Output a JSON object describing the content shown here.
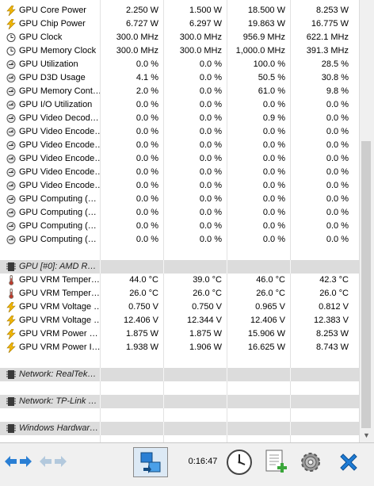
{
  "rows": [
    {
      "icon": "bolt",
      "name": "GPU Core Power",
      "v": [
        "2.250 W",
        "1.500 W",
        "18.500 W",
        "8.253 W"
      ]
    },
    {
      "icon": "bolt",
      "name": "GPU Chip Power",
      "v": [
        "6.727 W",
        "6.297 W",
        "19.863 W",
        "16.775 W"
      ]
    },
    {
      "icon": "clock",
      "name": "GPU Clock",
      "v": [
        "300.0 MHz",
        "300.0 MHz",
        "956.9 MHz",
        "622.1 MHz"
      ]
    },
    {
      "icon": "clock",
      "name": "GPU Memory Clock",
      "v": [
        "300.0 MHz",
        "300.0 MHz",
        "1,000.0 MHz",
        "391.3 MHz"
      ]
    },
    {
      "icon": "gauge",
      "name": "GPU Utilization",
      "v": [
        "0.0 %",
        "0.0 %",
        "100.0 %",
        "28.5 %"
      ]
    },
    {
      "icon": "gauge",
      "name": "GPU D3D Usage",
      "v": [
        "4.1 %",
        "0.0 %",
        "50.5 %",
        "30.8 %"
      ]
    },
    {
      "icon": "gauge",
      "name": "GPU Memory Cont…",
      "v": [
        "2.0 %",
        "0.0 %",
        "61.0 %",
        "9.8 %"
      ]
    },
    {
      "icon": "gauge",
      "name": "GPU I/O Utilization",
      "v": [
        "0.0 %",
        "0.0 %",
        "0.0 %",
        "0.0 %"
      ]
    },
    {
      "icon": "gauge",
      "name": "GPU Video Decod…",
      "v": [
        "0.0 %",
        "0.0 %",
        "0.9 %",
        "0.0 %"
      ]
    },
    {
      "icon": "gauge",
      "name": "GPU Video Encode…",
      "v": [
        "0.0 %",
        "0.0 %",
        "0.0 %",
        "0.0 %"
      ]
    },
    {
      "icon": "gauge",
      "name": "GPU Video Encode…",
      "v": [
        "0.0 %",
        "0.0 %",
        "0.0 %",
        "0.0 %"
      ]
    },
    {
      "icon": "gauge",
      "name": "GPU Video Encode…",
      "v": [
        "0.0 %",
        "0.0 %",
        "0.0 %",
        "0.0 %"
      ]
    },
    {
      "icon": "gauge",
      "name": "GPU Video Encode…",
      "v": [
        "0.0 %",
        "0.0 %",
        "0.0 %",
        "0.0 %"
      ]
    },
    {
      "icon": "gauge",
      "name": "GPU Video Encode…",
      "v": [
        "0.0 %",
        "0.0 %",
        "0.0 %",
        "0.0 %"
      ]
    },
    {
      "icon": "gauge",
      "name": "GPU Computing (…",
      "v": [
        "0.0 %",
        "0.0 %",
        "0.0 %",
        "0.0 %"
      ]
    },
    {
      "icon": "gauge",
      "name": "GPU Computing (…",
      "v": [
        "0.0 %",
        "0.0 %",
        "0.0 %",
        "0.0 %"
      ]
    },
    {
      "icon": "gauge",
      "name": "GPU Computing (…",
      "v": [
        "0.0 %",
        "0.0 %",
        "0.0 %",
        "0.0 %"
      ]
    },
    {
      "icon": "gauge",
      "name": "GPU Computing (…",
      "v": [
        "0.0 %",
        "0.0 %",
        "0.0 %",
        "0.0 %"
      ]
    },
    {
      "type": "blank"
    },
    {
      "type": "section",
      "icon": "chip",
      "name": "GPU [#0]: AMD R…"
    },
    {
      "icon": "thermo",
      "name": "GPU VRM Temper…",
      "v": [
        "44.0 °C",
        "39.0 °C",
        "46.0 °C",
        "42.3 °C"
      ]
    },
    {
      "icon": "thermo",
      "name": "GPU VRM Temper…",
      "v": [
        "26.0 °C",
        "26.0 °C",
        "26.0 °C",
        "26.0 °C"
      ]
    },
    {
      "icon": "bolt",
      "name": "GPU VRM Voltage …",
      "v": [
        "0.750 V",
        "0.750 V",
        "0.965 V",
        "0.812 V"
      ]
    },
    {
      "icon": "bolt",
      "name": "GPU VRM Voltage …",
      "v": [
        "12.406 V",
        "12.344 V",
        "12.406 V",
        "12.383 V"
      ]
    },
    {
      "icon": "bolt",
      "name": "GPU VRM Power …",
      "v": [
        "1.875 W",
        "1.875 W",
        "15.906 W",
        "8.253 W"
      ]
    },
    {
      "icon": "bolt",
      "name": "GPU VRM Power I…",
      "v": [
        "1.938 W",
        "1.906 W",
        "16.625 W",
        "8.743 W"
      ]
    },
    {
      "type": "blank"
    },
    {
      "type": "section",
      "icon": "chip",
      "name": "Network: RealTek…"
    },
    {
      "type": "blank"
    },
    {
      "type": "section",
      "icon": "chip",
      "name": "Network: TP-Link …"
    },
    {
      "type": "blank"
    },
    {
      "type": "section",
      "icon": "chip",
      "name": "Windows Hardwar…"
    }
  ],
  "toolbar": {
    "timer": "0:16:47"
  },
  "colors": {
    "bolt": "#f2b705",
    "thermo": "#7a6a60",
    "blue": "#2a7fd4",
    "close": "#1e7cd6"
  }
}
